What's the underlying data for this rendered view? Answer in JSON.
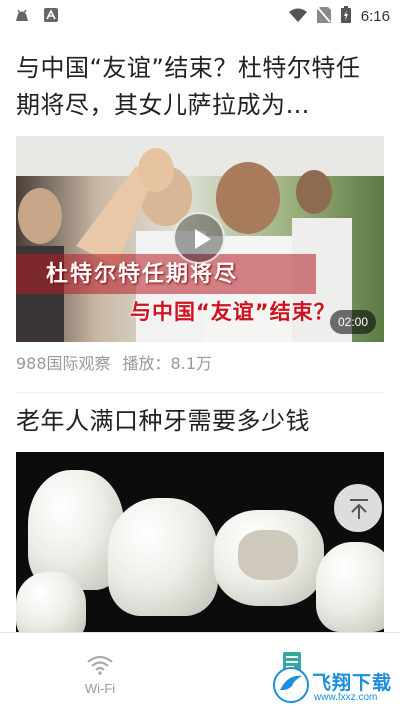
{
  "status_bar": {
    "time": "6:16"
  },
  "feed": [
    {
      "title": "与中国“友谊”结束？杜特尔特任期将尽，其女儿萨拉成为…",
      "video": {
        "caption_line1": "杜特尔特任期将尽",
        "caption_line2": "与中国“友谊”结束？",
        "duration": "02:00"
      },
      "source": "988国际观察",
      "plays": "播放：8.1万"
    },
    {
      "title": "老年人满口种牙需要多少钱"
    }
  ],
  "tabbar": {
    "tabs": [
      {
        "label": "Wi-Fi",
        "icon": "wifi-icon"
      },
      {
        "label": "",
        "icon": "news-icon"
      }
    ]
  },
  "watermark": {
    "text": "飞翔下载",
    "url": "www.fxxz.com"
  }
}
